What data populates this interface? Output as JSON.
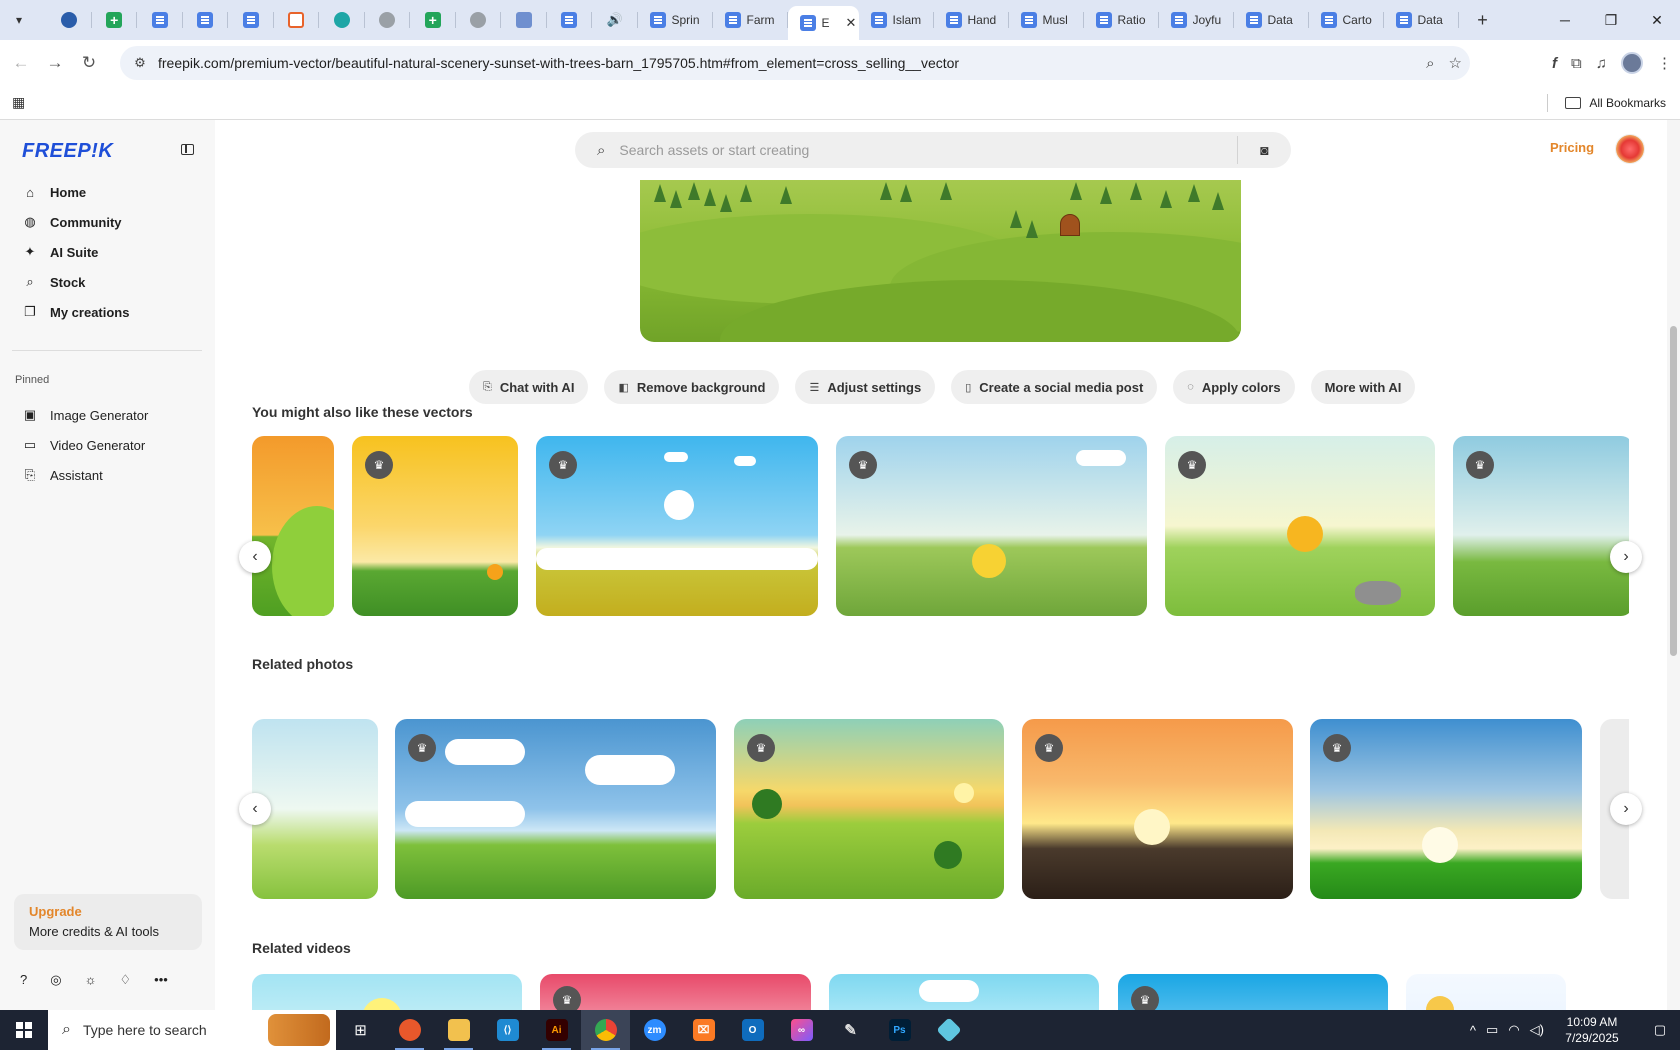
{
  "browser": {
    "tabs": [
      {
        "kind": "pinned",
        "favicon": "tab-menu-icon"
      },
      {
        "kind": "pinned",
        "favicon": "wordpress-icon"
      },
      {
        "kind": "pinned",
        "favicon": "google-sheets-icon"
      },
      {
        "kind": "pinned",
        "favicon": "google-docs-icon"
      },
      {
        "kind": "pinned",
        "favicon": "google-docs-icon"
      },
      {
        "kind": "pinned",
        "favicon": "google-docs-icon"
      },
      {
        "kind": "pinned",
        "favicon": "orange-app-icon"
      },
      {
        "kind": "pinned",
        "favicon": "teal-app-icon"
      },
      {
        "kind": "pinned",
        "favicon": "openai-icon"
      },
      {
        "kind": "pinned",
        "favicon": "google-sheets-icon"
      },
      {
        "kind": "pinned",
        "favicon": "globe-icon"
      },
      {
        "kind": "pinned",
        "favicon": "grid-app-icon"
      },
      {
        "kind": "pinned",
        "favicon": "google-docs-icon"
      },
      {
        "kind": "pinned",
        "favicon": "speaker-icon"
      }
    ],
    "named_tabs": [
      {
        "label": "Sprin"
      },
      {
        "label": "Farm"
      },
      {
        "label": "E",
        "active": true
      },
      {
        "label": "Islam"
      },
      {
        "label": "Hand"
      },
      {
        "label": "Musl"
      },
      {
        "label": "Ratio"
      },
      {
        "label": "Joyfu"
      },
      {
        "label": "Data"
      },
      {
        "label": "Carto"
      },
      {
        "label": "Data"
      }
    ],
    "new_tab_label": "+",
    "url_host": "freepik.com",
    "url_path": "/premium-vector/beautiful-natural-scenery-sunset-with-trees-barn_1795705.htm#from_element=cross_selling__vector",
    "all_bookmarks": "All Bookmarks"
  },
  "sidebar": {
    "logo": "FREEP!K",
    "nav": [
      {
        "label": "Home",
        "icon": "home-icon",
        "glyph": "⌂"
      },
      {
        "label": "Community",
        "icon": "globe-icon",
        "glyph": "◍"
      },
      {
        "label": "AI Suite",
        "icon": "sparkle-icon",
        "glyph": "✦"
      },
      {
        "label": "Stock",
        "icon": "search-icon",
        "glyph": "⌕"
      },
      {
        "label": "My creations",
        "icon": "stack-icon",
        "glyph": "❐"
      }
    ],
    "pinned_heading": "Pinned",
    "pinned": [
      {
        "label": "Image Generator",
        "icon": "image-icon",
        "glyph": "▣"
      },
      {
        "label": "Video Generator",
        "icon": "video-icon",
        "glyph": "▭"
      },
      {
        "label": "Assistant",
        "icon": "chat-icon",
        "glyph": "⎘"
      }
    ],
    "upgrade_title": "Upgrade",
    "upgrade_sub": "More credits & AI tools"
  },
  "header": {
    "search_placeholder": "Search assets or start creating",
    "pricing": "Pricing"
  },
  "actions": [
    {
      "label": "Chat with AI",
      "icon": "chat-ai-icon",
      "glyph": "⎘"
    },
    {
      "label": "Remove background",
      "icon": "remove-bg-icon",
      "glyph": "◧"
    },
    {
      "label": "Adjust settings",
      "icon": "sliders-icon",
      "glyph": "☰"
    },
    {
      "label": "Create a social media post",
      "icon": "phone-icon",
      "glyph": "▯"
    },
    {
      "label": "Apply colors",
      "icon": "palette-icon",
      "glyph": "◌"
    },
    {
      "label": "More with AI",
      "icon": "",
      "glyph": ""
    }
  ],
  "sections": {
    "vectors_title": "You might also like these vectors",
    "photos_title": "Related photos",
    "videos_title": "Related videos"
  },
  "taskbar": {
    "search_text": "Type here to search",
    "time": "10:09 AM",
    "date": "7/29/2025"
  }
}
